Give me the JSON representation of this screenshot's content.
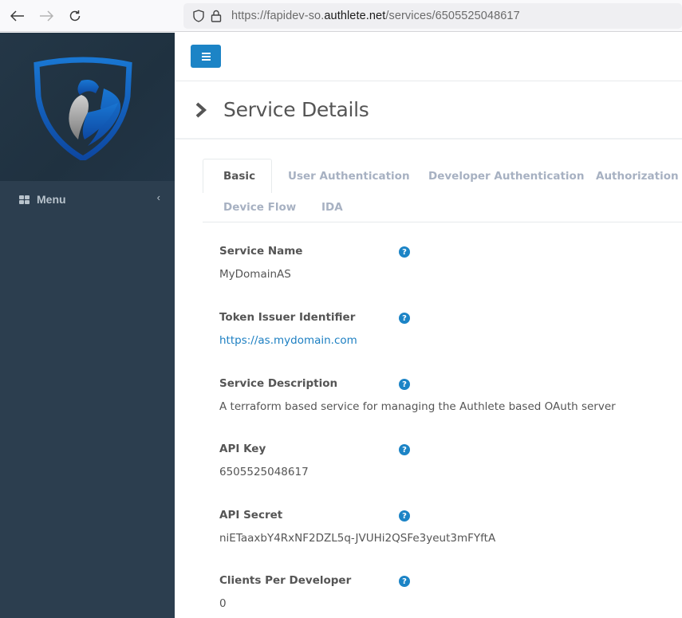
{
  "browser": {
    "url_prefix": "https://fapidev-so.",
    "url_host": "authlete.net",
    "url_path": "/services/6505525048617",
    "back_icon": "arrow-left-icon",
    "forward_icon": "arrow-right-icon",
    "reload_icon": "reload-icon",
    "shield_icon": "shield-icon",
    "lock_icon": "lock-icon"
  },
  "sidebar": {
    "logo": "authlete-eagle-shield-logo",
    "menu_label": "Menu",
    "menu_icon": "grid-icon",
    "collapse_icon": "chevron-left-icon",
    "colors": {
      "background": "#2c3e4f",
      "logo_blue": "#1565c0"
    }
  },
  "topbar": {
    "toggle_icon": "hamburger-icon",
    "accent": "#1c84c6"
  },
  "page": {
    "title": "Service Details",
    "title_icon": "chevron-right-icon"
  },
  "tabs": [
    {
      "label": "Basic",
      "active": true
    },
    {
      "label": "User Authentication",
      "active": false
    },
    {
      "label": "Developer Authentication",
      "active": false
    },
    {
      "label": "Authorization",
      "active": false
    },
    {
      "label": "Device Flow",
      "active": false
    },
    {
      "label": "IDA",
      "active": false
    }
  ],
  "fields": [
    {
      "label": "Service Name",
      "value": "MyDomainAS",
      "is_link": false
    },
    {
      "label": "Token Issuer Identifier",
      "value": "https://as.mydomain.com",
      "is_link": true
    },
    {
      "label": "Service Description",
      "value": "A terraform based service for managing the Authlete based OAuth server",
      "is_link": false
    },
    {
      "label": "API Key",
      "value": "6505525048617",
      "is_link": false
    },
    {
      "label": "API Secret",
      "value": "niETaaxbY4RxNF2DZL5q-JVUHi2QSFe3yeut3mFYftA",
      "is_link": false
    },
    {
      "label": "Clients Per Developer",
      "value": "0",
      "is_link": false
    }
  ],
  "help_glyph": "?"
}
